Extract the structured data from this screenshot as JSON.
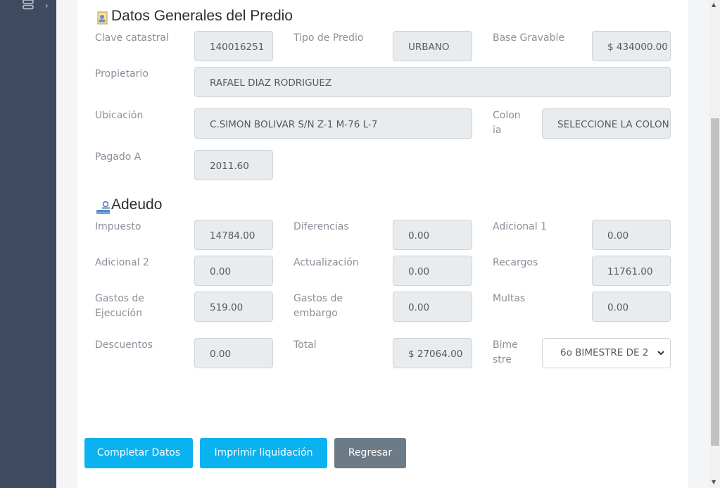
{
  "sidebar": {
    "menu_icon": "stack-icon",
    "expand_icon": "chevron-right-icon"
  },
  "general": {
    "title": "Datos Generales del Predio",
    "icon": "document-user-icon",
    "clave_label": "Clave catastral",
    "clave_value": "140016251",
    "tipo_label": "Tipo de Predio",
    "tipo_value": "URBANO",
    "base_label": "Base Gravable",
    "base_value": "$ 434000.00",
    "propietario_label": "Propietario",
    "propietario_value": "RAFAEL DIAZ RODRIGUEZ",
    "ubicacion_label": "Ubicación",
    "ubicacion_value": "C.SIMON BOLIVAR S/N  Z-1 M-76 L-7",
    "colonia_label_1": "Colon",
    "colonia_label_2": "ia",
    "colonia_value": "SELECCIONE LA COLONIA",
    "pagado_label": "Pagado A",
    "pagado_value": "2011.60"
  },
  "adeudo": {
    "title": "Adeudo",
    "icon": "user-stack-icon",
    "impuesto_label": "Impuesto",
    "impuesto_value": "14784.00",
    "diferencias_label": "Diferencias",
    "diferencias_value": "0.00",
    "adicional1_label": "Adicional 1",
    "adicional1_value": "0.00",
    "adicional2_label": "Adicional 2",
    "adicional2_value": "0.00",
    "actualizacion_label": "Actualización",
    "actualizacion_value": "0.00",
    "recargos_label": "Recargos",
    "recargos_value": "11761.00",
    "gastos_ejec_label_1": "Gastos de",
    "gastos_ejec_label_2": "Ejecución",
    "gastos_ejec_value": "519.00",
    "gastos_emb_label_1": "Gastos de",
    "gastos_emb_label_2": "embargo",
    "gastos_emb_value": "0.00",
    "multas_label": "Multas",
    "multas_value": "0.00",
    "descuentos_label": "Descuentos",
    "descuentos_value": "0.00",
    "total_label": "Total",
    "total_value": "$ 27064.00",
    "bimestre_label_1": "Bime",
    "bimestre_label_2": "stre",
    "bimestre_value": "6o BIMESTRE DE 2"
  },
  "buttons": {
    "completar": "Completar Datos",
    "imprimir": "Imprimir liquidación",
    "regresar": "Regresar"
  },
  "colors": {
    "sidebar": "#3d4a5f",
    "primary": "#0bb2f0",
    "secondary": "#6c7b86"
  }
}
